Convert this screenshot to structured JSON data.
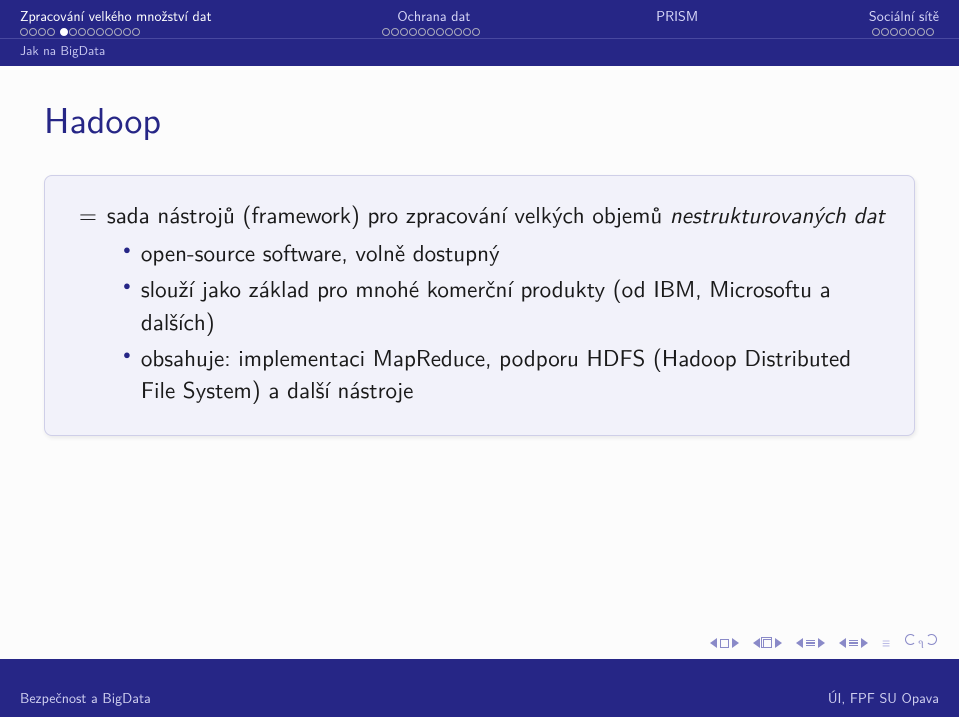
{
  "header": {
    "sections": [
      {
        "label": "Zpracování velkého množství dat",
        "dots": [
          [
            0,
            0,
            0,
            0
          ],
          [
            1,
            0,
            0,
            0,
            0,
            0,
            0,
            0,
            0
          ]
        ],
        "active": true
      },
      {
        "label": "Ochrana dat",
        "dots": [
          [
            0,
            0,
            0,
            0,
            0,
            0,
            0,
            0,
            0,
            0,
            0
          ]
        ],
        "active": false
      },
      {
        "label": "PRISM",
        "dots": [],
        "active": false
      },
      {
        "label": "Sociální sítě",
        "dots": [
          [
            0,
            0,
            0,
            0,
            0,
            0,
            0
          ]
        ],
        "active": false
      }
    ],
    "subsection": "Jak na BigData"
  },
  "frame": {
    "title": "Hadoop",
    "eq_sign": "=",
    "intro_a": "sada nástrojů (framework) pro zpracování velkých objemů ",
    "intro_b": "nestrukturovaných dat",
    "bullets": [
      "open-source software, volně dostupný",
      "slouží jako základ pro mnohé komerční produkty (od IBM, Microsoftu a dalších)",
      "obsahuje: implementaci MapReduce, podporu HDFS (Hadoop Distributed File System) a další nástroje"
    ]
  },
  "footer": {
    "left": "Bezpečnost a BigData",
    "right": "ÚI, FPF SU Opava"
  },
  "nav": {
    "prev_slide": "prev-slide",
    "next_slide": "next-slide",
    "prev_frame": "prev-frame",
    "next_frame": "next-frame"
  }
}
